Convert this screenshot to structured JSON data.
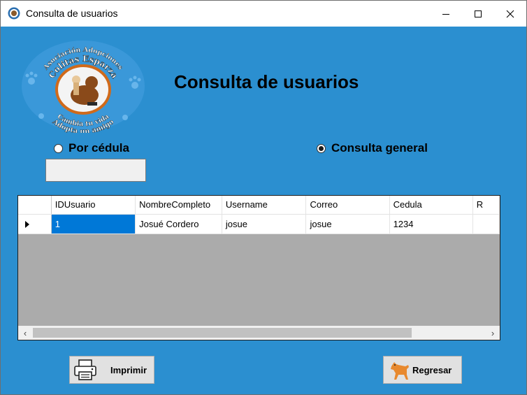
{
  "window": {
    "title": "Consulta de usuarios"
  },
  "logo": {
    "text_top": "Asociación Adopciones",
    "text_name": "Colitas Esparza",
    "text_bottom1": "Cambia tu vida",
    "text_bottom2": "Adopta un amigo"
  },
  "page": {
    "heading": "Consulta de usuarios"
  },
  "search": {
    "option_cedula": "Por cédula",
    "option_general": "Consulta general",
    "selected": "general",
    "cedula_value": ""
  },
  "grid": {
    "columns": [
      "IDUsuario",
      "NombreCompleto",
      "Username",
      "Correo",
      "Cedula",
      "R"
    ],
    "rows": [
      {
        "IDUsuario": "1",
        "NombreCompleto": "Josué Cordero",
        "Username": "josue",
        "Correo": "josue",
        "Cedula": "1234",
        "R": ""
      }
    ],
    "scroll_left": "‹",
    "scroll_right": "›"
  },
  "buttons": {
    "print_label": "Imprimir",
    "back_label": "Regresar"
  },
  "colors": {
    "background": "#2b8fd0",
    "grid_background": "#ababab",
    "selection": "#0078d7"
  }
}
